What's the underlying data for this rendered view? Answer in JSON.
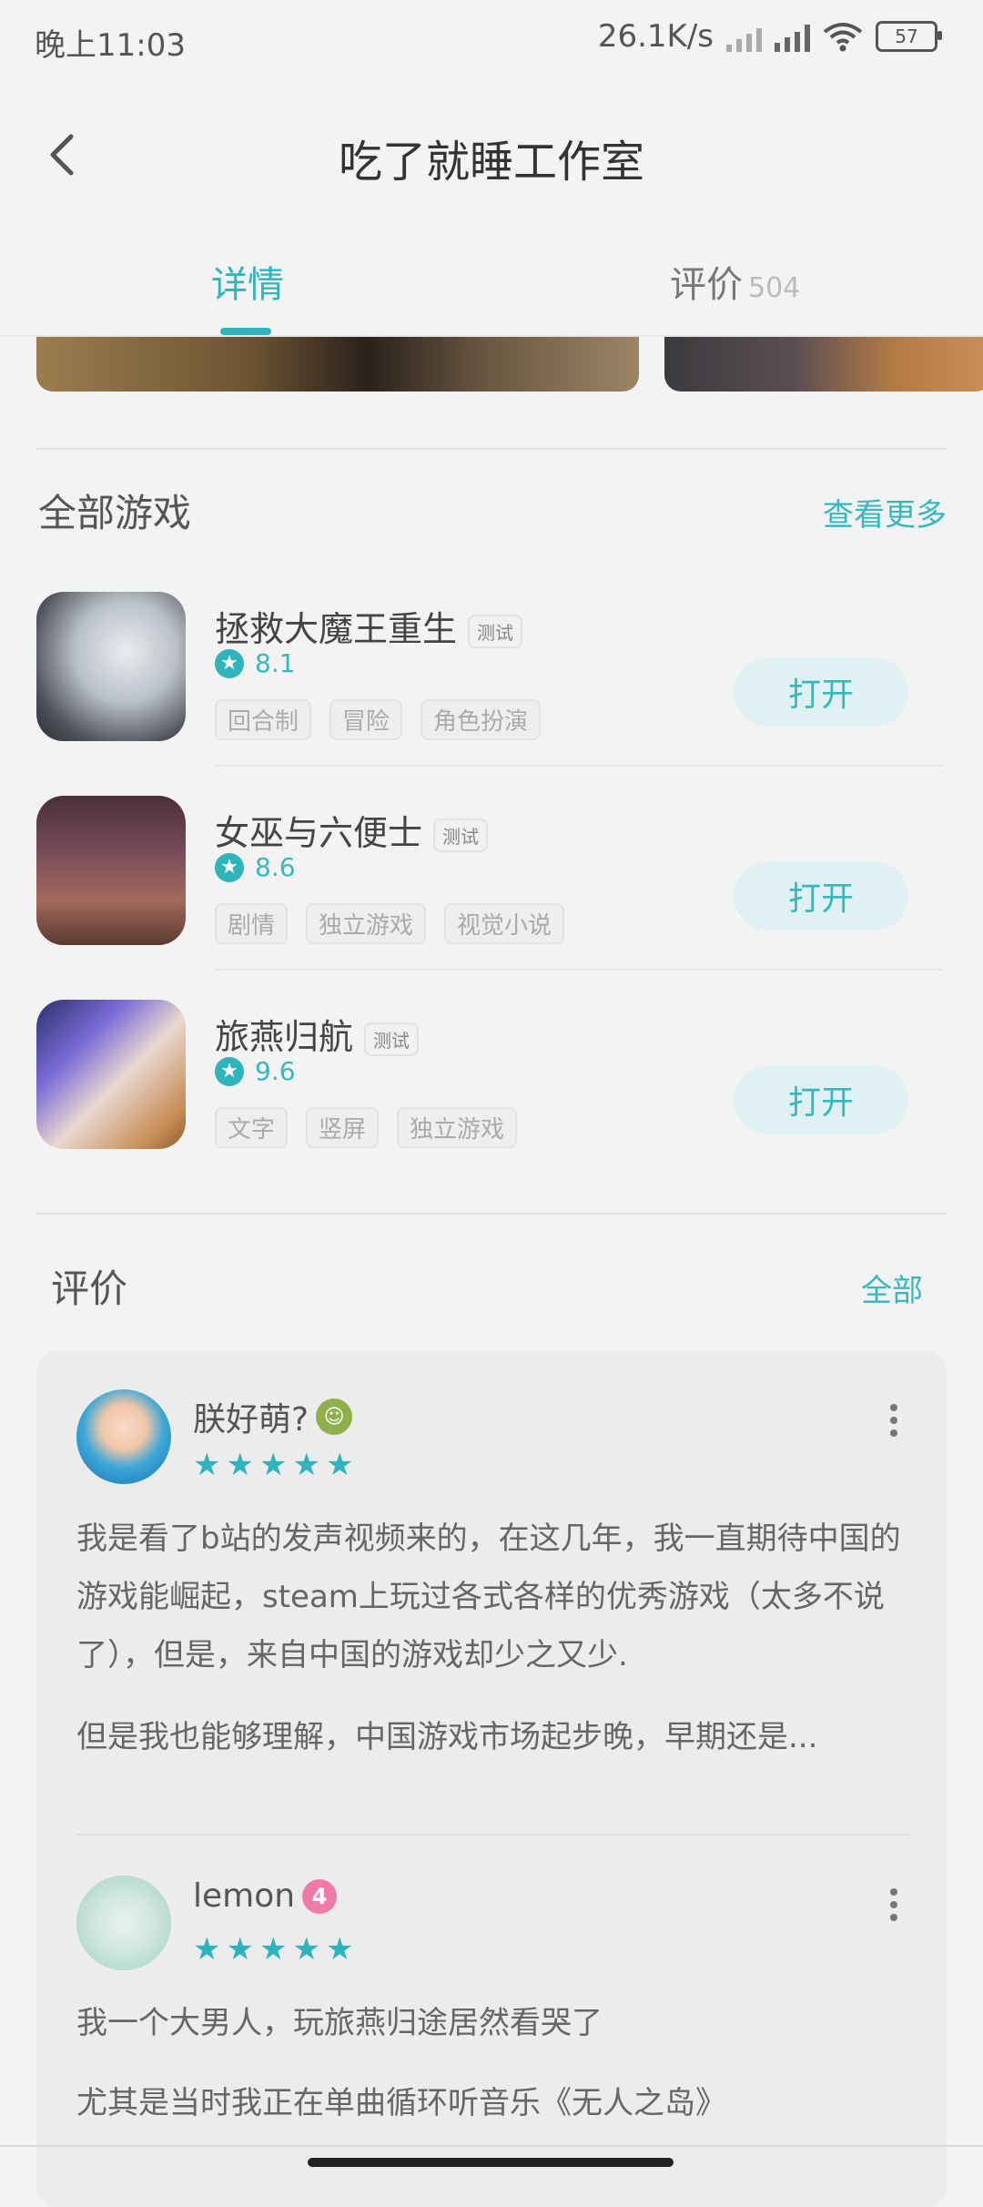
{
  "status": {
    "time": "晚上11:03",
    "speed": "26.1K/s",
    "battery": "57"
  },
  "header": {
    "title": "吃了就睡工作室"
  },
  "tabs": [
    {
      "label": "详情"
    },
    {
      "label": "评价",
      "count": "504"
    }
  ],
  "games_section": {
    "title": "全部游戏",
    "more": "查看更多",
    "games": [
      {
        "name": "拯救大魔王重生",
        "badge": "测试",
        "rating": "8.1",
        "tags": [
          "回合制",
          "冒险",
          "角色扮演"
        ],
        "button": "打开"
      },
      {
        "name": "女巫与六便士",
        "badge": "测试",
        "rating": "8.6",
        "tags": [
          "剧情",
          "独立游戏",
          "视觉小说"
        ],
        "button": "打开"
      },
      {
        "name": "旅燕归航",
        "badge": "测试",
        "rating": "9.6",
        "tags": [
          "文字",
          "竖屏",
          "独立游戏"
        ],
        "button": "打开"
      }
    ]
  },
  "reviews_section": {
    "title": "评价",
    "more": "全部",
    "reviews": [
      {
        "user": "朕好萌?",
        "stars": 5,
        "paragraphs": [
          "我是看了b站的发声视频来的，在这几年，我一直期待中国的游戏能崛起，steam上玩过各式各样的优秀游戏（太多不说了），但是，来自中国的游戏却少之又少.",
          "但是我也能够理解，中国游戏市场起步晚，早期还是..."
        ]
      },
      {
        "user": "lemon",
        "level": "4",
        "stars": 5,
        "paragraphs": [
          "我一个大男人，玩旅燕归途居然看哭了",
          "尤其是当时我正在单曲循环听音乐《无人之岛》"
        ]
      }
    ]
  }
}
